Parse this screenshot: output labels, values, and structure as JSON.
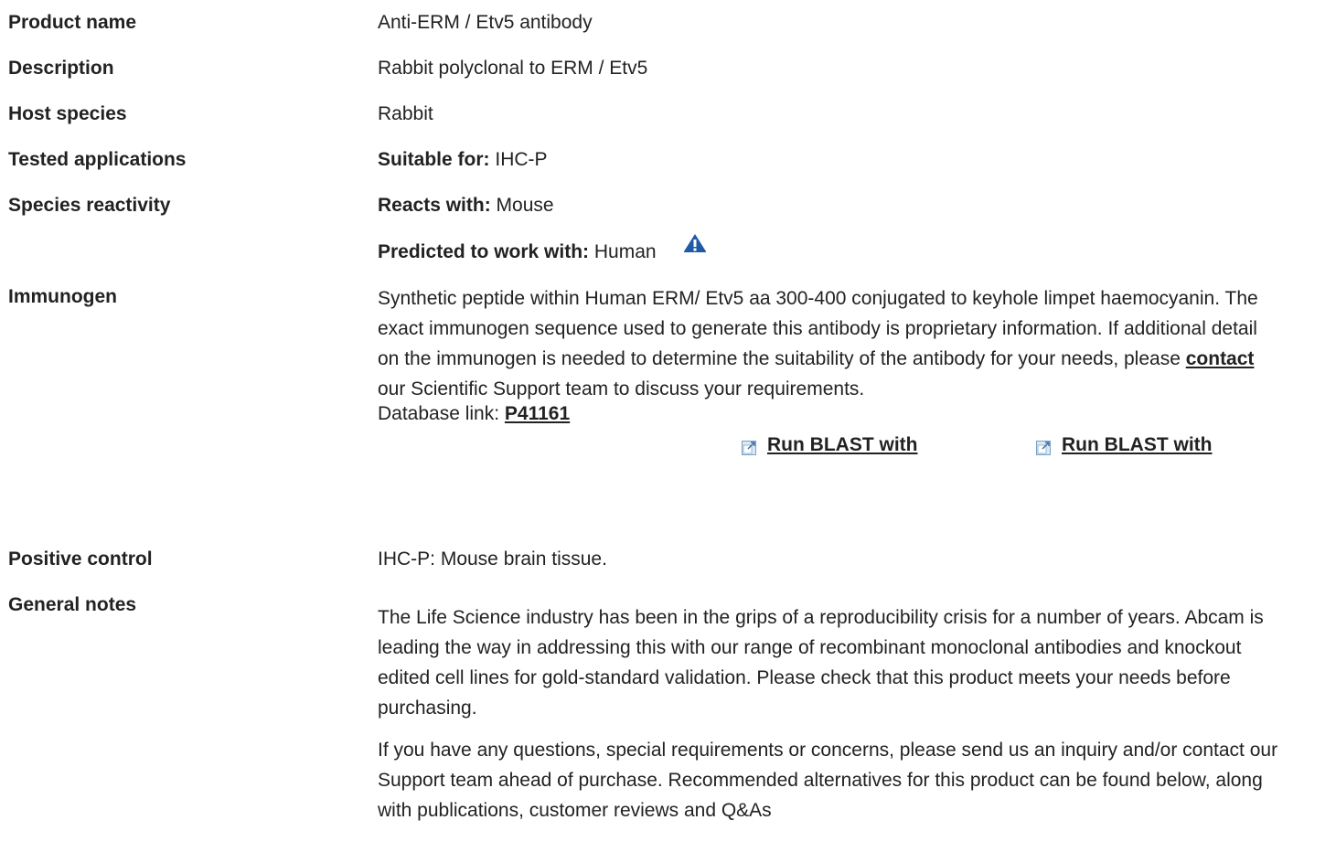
{
  "rows": {
    "product_name": {
      "label": "Product name",
      "value": "Anti-ERM / Etv5 antibody"
    },
    "description": {
      "label": "Description",
      "value": "Rabbit polyclonal to ERM / Etv5"
    },
    "host_species": {
      "label": "Host species",
      "value": "Rabbit"
    },
    "tested_applications": {
      "label": "Tested applications",
      "prefix": "Suitable for:",
      "value": "IHC-P"
    },
    "species_reactivity": {
      "label": "Species reactivity",
      "reacts_prefix": "Reacts with:",
      "reacts_value": "Mouse",
      "predicted_prefix": "Predicted to work with:",
      "predicted_value": "Human",
      "warning_icon": "warning-triangle-icon"
    },
    "immunogen": {
      "label": "Immunogen",
      "text_before_link": "Synthetic peptide within Human ERM/ Etv5 aa 300-400 conjugated to keyhole limpet haemocyanin. The exact immunogen sequence used to generate this antibody is proprietary information. If additional detail on the immunogen is needed to determine the suitability of the antibody for your needs, please",
      "contact_link": "contact",
      "text_after_link": "our Scientific Support team to discuss your requirements.",
      "database_prefix": "Database link:",
      "database_link": "P41161",
      "blast_1": "Run BLAST with",
      "blast_2": "Run BLAST with",
      "blast_icon": "external-link-icon"
    },
    "positive_control": {
      "label": "Positive control",
      "value": "IHC-P: Mouse brain tissue."
    },
    "general_notes": {
      "label": "General notes",
      "para_1": "The Life Science industry has been in the grips of a reproducibility crisis for a number of years. Abcam is leading the way in addressing this with our range of recombinant monoclonal antibodies and knockout edited cell lines for gold-standard validation. Please check that this product meets your needs before purchasing.",
      "para_2": "If you have any questions, special requirements or concerns, please send us an inquiry and/or contact our Support team ahead of purchase. Recommended alternatives for this product can be found below, along with publications, customer reviews and Q&As"
    }
  },
  "colors": {
    "text": "#222222",
    "warning_icon": "#1f5aa6",
    "external_icon": "#7aa2c8"
  }
}
